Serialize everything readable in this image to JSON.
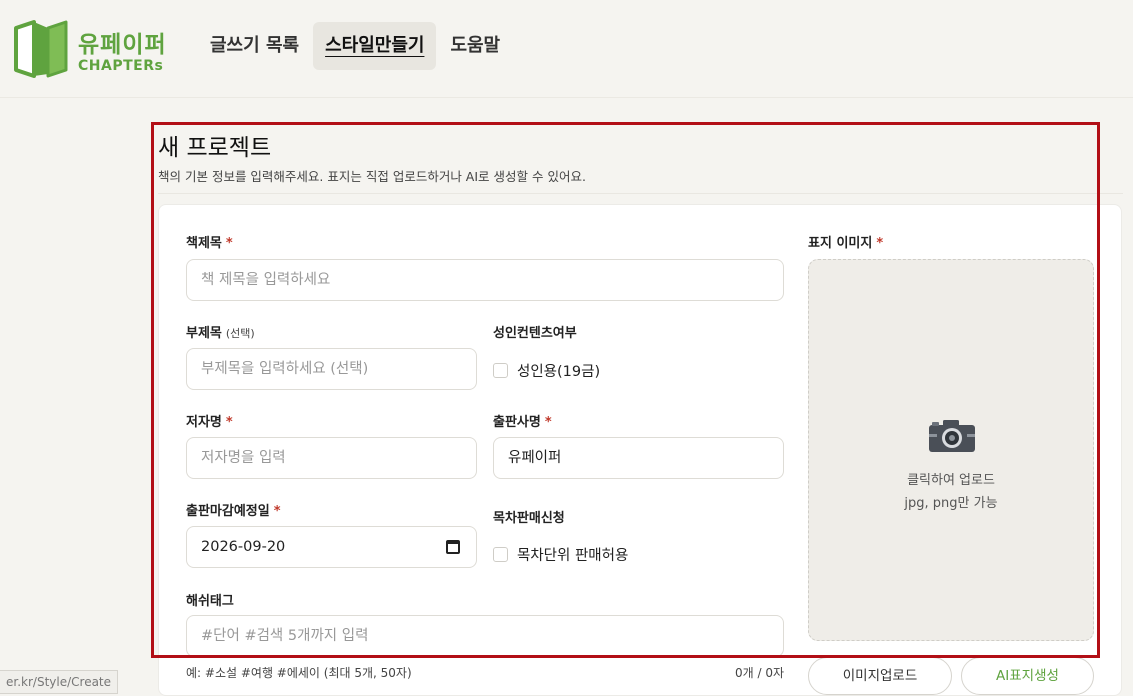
{
  "brand": {
    "name": "유페이퍼",
    "sub": "CHAPTERs",
    "color": "#5fa33f"
  },
  "nav": {
    "items": [
      {
        "label": "글쓰기 목록",
        "active": false
      },
      {
        "label": "스타일만들기",
        "active": true
      },
      {
        "label": "도움말",
        "active": false
      }
    ]
  },
  "status_url": "er.kr/Style/Create",
  "page": {
    "title": "새 프로젝트",
    "description": "책의 기본 정보를 입력해주세요. 표지는 직접 업로드하거나 AI로 생성할 수 있어요."
  },
  "form": {
    "title": {
      "label": "책제목",
      "required": "*",
      "placeholder": "책 제목을 입력하세요"
    },
    "subtitle": {
      "label": "부제목",
      "optional": "(선택)",
      "placeholder": "부제목을 입력하세요 (선택)"
    },
    "adult": {
      "label": "성인컨텐츠여부",
      "checkbox_label": "성인용(19금)",
      "checked": false
    },
    "author": {
      "label": "저자명",
      "required": "*",
      "placeholder": "저자명을 입력"
    },
    "publisher": {
      "label": "출판사명",
      "required": "*",
      "value": "유페이퍼"
    },
    "deadline": {
      "label": "출판마감예정일",
      "required": "*",
      "value": "2026-09-20",
      "icon": "calendar-icon"
    },
    "chapter_sale": {
      "label": "목차판매신청",
      "checkbox_label": "목차단위 판매허용",
      "checked": false
    },
    "hashtags": {
      "label": "해쉬태그",
      "placeholder": "#단어 #검색 5개까지 입력",
      "helper": "예: #소설 #여행 #에세이 (최대 5개, 50자)",
      "counter": "0개 / 0자"
    }
  },
  "cover": {
    "label": "표지 이미지",
    "required": "*",
    "icon": "camera-icon",
    "upload_hint": "클릭하여 업로드",
    "format_hint": "jpg, png만 가능",
    "upload_button": "이미지업로드",
    "ai_button": "AI표지생성"
  },
  "colors": {
    "accent": "#5fa33f",
    "required": "#c0392b",
    "highlight": "#b20f16"
  }
}
